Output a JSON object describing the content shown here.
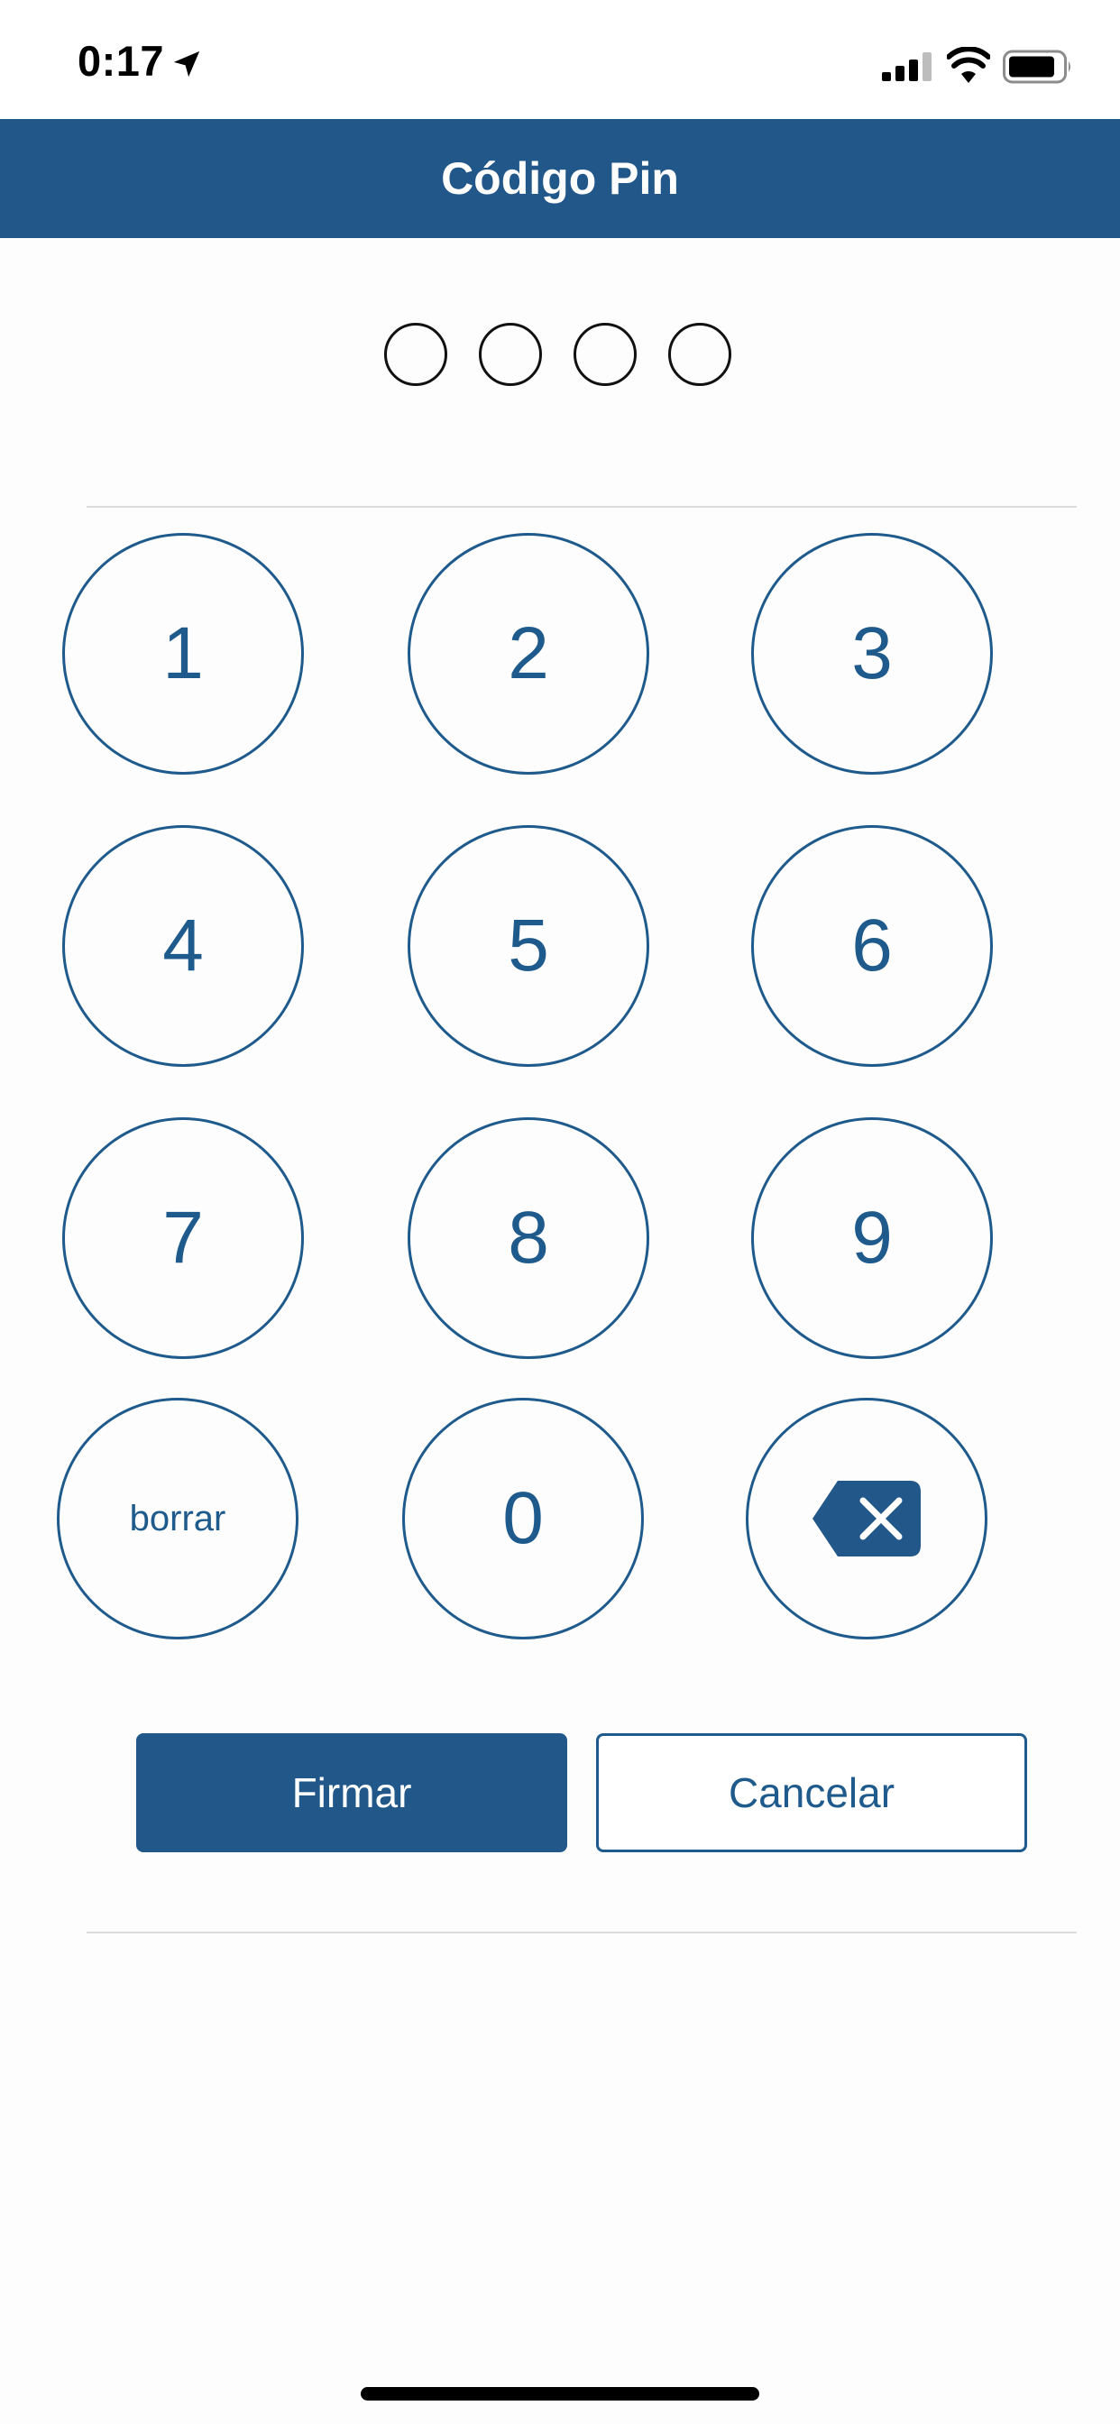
{
  "status_bar": {
    "time": "0:17",
    "icons": [
      "location-arrow-icon",
      "cellular-signal-icon",
      "wifi-icon",
      "battery-icon"
    ]
  },
  "header": {
    "title": "Código Pin",
    "background_color": "#225789"
  },
  "pin": {
    "length": 4,
    "filled": 0
  },
  "keypad": {
    "keys": [
      "1",
      "2",
      "3",
      "4",
      "5",
      "6",
      "7",
      "8",
      "9"
    ],
    "clear_label": "borrar",
    "zero_label": "0",
    "backspace_icon": "backspace-icon"
  },
  "actions": {
    "sign_label": "Firmar",
    "cancel_label": "Cancelar"
  },
  "colors": {
    "accent": "#225789",
    "key_outline": "#1f5a8c"
  }
}
